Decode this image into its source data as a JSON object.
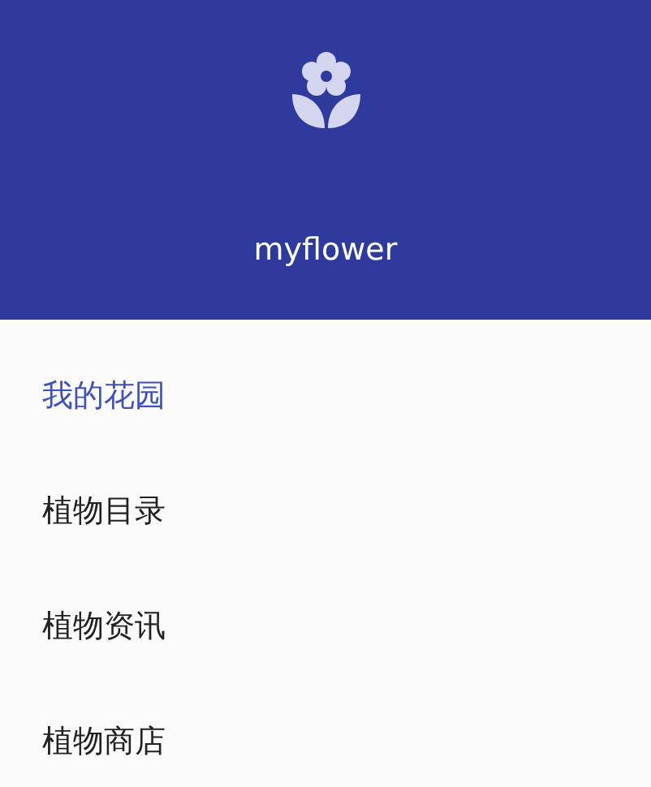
{
  "header": {
    "title": "myflower"
  },
  "menu": [
    {
      "label": "我的花园",
      "selected": true
    },
    {
      "label": "植物目录",
      "selected": false
    },
    {
      "label": "植物资讯",
      "selected": false
    },
    {
      "label": "植物商店",
      "selected": false
    }
  ]
}
